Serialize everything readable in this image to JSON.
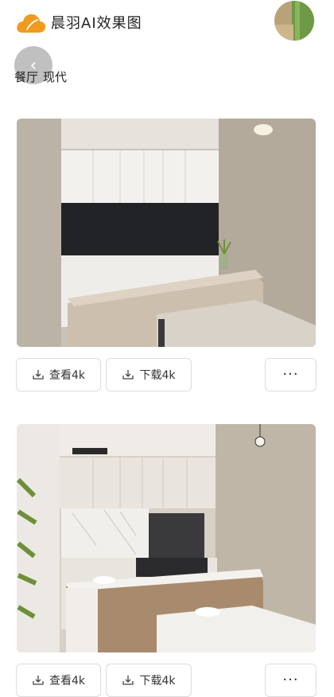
{
  "app": {
    "title": "晨羽AI效果图"
  },
  "breadcrumb": [
    "餐厅",
    "现代"
  ],
  "cards": [
    {
      "view_label": "查看4k",
      "download_label": "下载4k",
      "more_label": "···"
    },
    {
      "view_label": "查看4k",
      "download_label": "下载4k",
      "more_label": "···"
    }
  ],
  "colors": {
    "accent": "#F29A1F",
    "border": "#DCDCDC"
  },
  "icons": [
    "cloud-logo-icon",
    "back-arrow-icon",
    "download-icon",
    "more-icon"
  ]
}
